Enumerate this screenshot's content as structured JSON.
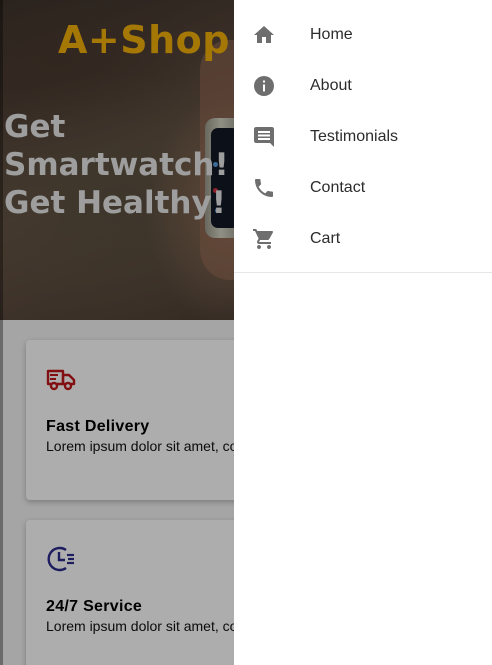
{
  "brand": {
    "name": "A+Shop"
  },
  "hero": {
    "title": "Get Smartwatch! Get Healthy!"
  },
  "features": [
    {
      "icon": "truck-icon",
      "icon_color": "#c0191b",
      "title": "Fast Delivery",
      "text": "Lorem ipsum dolor sit amet, co"
    },
    {
      "icon": "clock-fast-icon",
      "icon_color": "#2a2a8c",
      "title": "24/7 Service",
      "text": "Lorem ipsum dolor sit amet, co"
    }
  ],
  "drawer": {
    "items": [
      {
        "label": "Home",
        "icon": "home-icon"
      },
      {
        "label": "About",
        "icon": "info-icon"
      },
      {
        "label": "Testimonials",
        "icon": "comment-icon"
      },
      {
        "label": "Contact",
        "icon": "phone-icon"
      },
      {
        "label": "Cart",
        "icon": "cart-icon"
      }
    ]
  },
  "colors": {
    "brand": "#f3b10a",
    "drawer_icon": "#6e6e6e",
    "drawer_text": "#2c2c2c"
  }
}
